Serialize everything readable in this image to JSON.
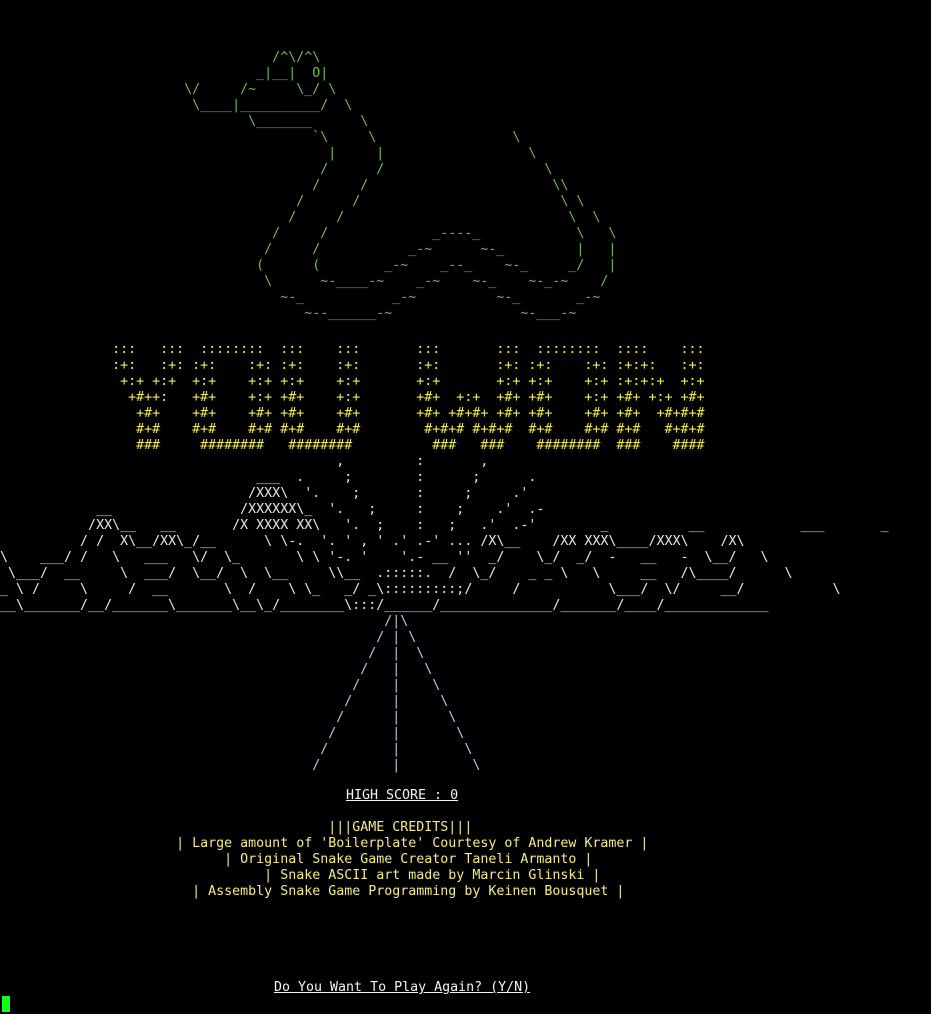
{
  "colors": {
    "background": "#000000",
    "snake": "#6fbf48",
    "title": "#f1ea4e",
    "mountains": "#e8e8e8",
    "road": "#c9c7ea",
    "credits": "#f5ec8a",
    "cursor": "#16ff16"
  },
  "snake_art": "                                  /^\\/^\\\n                                _|__|  O|\n                       \\/     /~     \\_/ \\\n                        \\____|__________/  \\\n                               \\_______      \\\n                                       `\\     \\                 \\\n                                         |     |                  \\\n                                        /      /                    \\\n                                       /     /                       \\\\\n                                     /      /                         \\ \\\n                                    /     /                            \\  \\\n                                  /     /             _----_            \\   \\\n                                 /     /           _-~      ~-_         |   |\n                                (      (        _-~    _--_    ~-_     _/   |\n                                 \\      ~-____-~    _-~    ~-_    ~-_-~    /\n                                   ~-_           _-~          ~-_       _-~\n                                      ~--______-~                ~-___-~",
  "title_art": "              :::   :::  ::::::::  :::    :::       :::       :::  ::::::::  ::::    :::\n              :+:   :+: :+:    :+: :+:    :+:       :+:       :+: :+:    :+: :+:+:   :+:\n               +:+ +:+  +:+    +:+ +:+    +:+       +:+       +:+ +:+    +:+ :+:+:+  +:+\n                +#++:   +#+    +:+ +#+    +:+       +#+  +:+  +#+ +#+    +:+ +#+ +:+ +#+\n                 +#+    +#+    +#+ +#+    +#+       +#+ +#+#+ +#+ +#+    +#+ +#+  +#+#+#\n                 #+#    #+#    #+# #+#    #+#        #+#+# #+#+#  #+#    #+# #+#   #+#+#\n                 ###     ########   ########          ###   ###    ########  ###    ####",
  "mountains_art": "                                          ,         :       ,\n                                ___  .     ;        :      ;      .\n                               /XXX\\  '.    ;       :     ;     .'\n            __                /XXXXXX\\_  '.   ;     :    ;    .'  .-\n           /XX\\__   __       /X XXXX XX\\   '.  ;    :   ;   .'  .-'        _          __            ___       _\n          / /  X\\__/XX\\_/__      \\ \\-.  '. ' , ' .' .-' ... /X\\__    /XX XXX\\____/XXX\\    /X\\\n\\    ___/ /   \\   ___   \\/  \\_       \\ \\ '-. '    '.- __ ''  _/    \\_/  _/  -   __   -  \\__/   \\\n \\___/  __     \\  ___/  \\__/  \\  \\__     \\\\__  .:::::.  /  \\_/    _ _ \\   \\     __   /\\____/      \\\n_ \\ /     \\     /  __       \\  /    \\ \\_   _/ _\\:::::::::;/     /           \\___/  \\/     __/           \\\n__\\_______/__/_______\\_______\\__\\_/________\\:::/______/______________/_______/____/_____________",
  "road_art": "                                                /|\\\n                                               / | \\\n                                              /  |  \\\n                                             /   |   \\\n                                            /    |    \\\n                                           /     |     \\\n                                          /      |      \\\n                                         /       |       \\\n                                        /        |        \\\n                                       /         |         \\",
  "high_score": "HIGH SCORE : 0",
  "credits_art": "                                         |||GAME CREDITS|||\n                      | Large amount of 'Boilerplate' Courtesy of Andrew Kramer |\n                            | Original Snake Game Creator Taneli Armanto |\n                                 | Snake ASCII art made by Marcin Glinski |\n                        | Assembly Snake Game Programming by Keinen Bousquet |",
  "prompt": "Do You Want To Play Again? (Y/N)"
}
